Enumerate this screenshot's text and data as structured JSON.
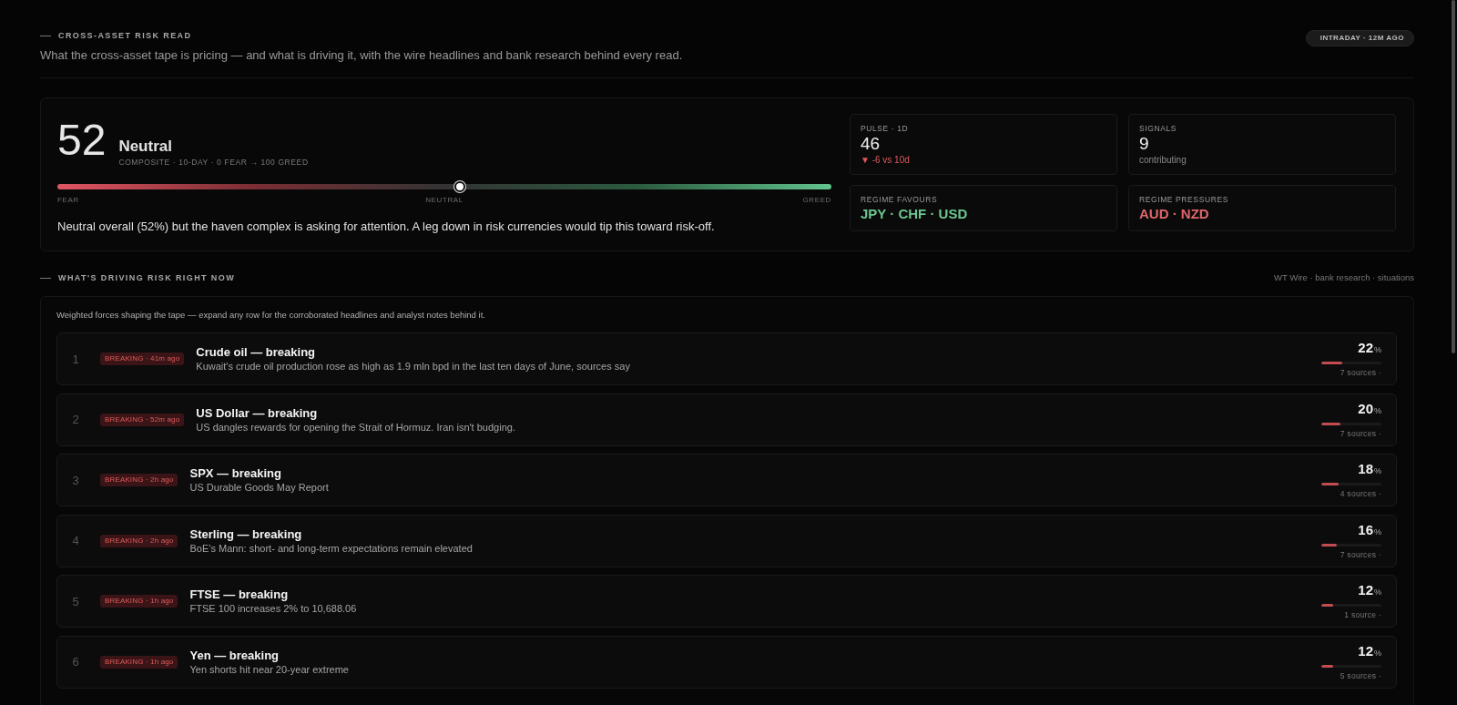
{
  "header": {
    "title": "CROSS-ASSET RISK READ",
    "subtitle": "What the cross-asset tape is pricing — and what is driving it, with the wire headlines and bank research behind every read.",
    "badge": "INTRADAY · 12M AGO"
  },
  "score": {
    "value": "52",
    "label": "Neutral",
    "caption": "COMPOSITE · 10-DAY · 0 FEAR → 100 GREED",
    "gauge": {
      "level": 0.52,
      "labels": [
        "FEAR",
        "NEUTRAL",
        "GREED"
      ]
    },
    "summary": "Neutral overall (52%) but the haven complex is asking for attention. A leg down in risk currencies would tip this toward risk-off."
  },
  "stats": [
    {
      "kind": "metric",
      "label": "PULSE · 1D",
      "value": "46",
      "note": "▼ -6 vs 10d",
      "color": "#de5a5e"
    },
    {
      "kind": "metric",
      "label": "SIGNALS",
      "value": "9",
      "note": "contributing"
    },
    {
      "kind": "currencies",
      "label": "REGIME FAVOURS",
      "value": "JPY · CHF · USD",
      "color": "#6cc690"
    },
    {
      "kind": "currencies",
      "label": "REGIME PRESSURES",
      "value": "AUD · NZD",
      "color": "#e0666c"
    }
  ],
  "drivers": {
    "title": "WHAT'S DRIVING RISK RIGHT NOW",
    "sources": "WT Wire · bank research · situations",
    "intro": "Weighted forces shaping the tape — expand any row for the corroborated headlines and analyst notes behind it.",
    "rows": [
      {
        "rank": "1",
        "badge": "BREAKING · 41m ago",
        "title": "Crude oil — breaking",
        "headline": "Kuwait's crude oil production rose as high as 1.9 mln bpd in the last ten days of June, sources say",
        "weight": "22",
        "unit": "%",
        "level": 0.35,
        "sources": "7 sources ·"
      },
      {
        "rank": "2",
        "badge": "BREAKING · 52m ago",
        "title": "US Dollar — breaking",
        "headline": "US dangles rewards for opening the Strait of Hormuz. Iran isn't budging.",
        "weight": "20",
        "unit": "%",
        "level": 0.32,
        "sources": "7 sources ·"
      },
      {
        "rank": "3",
        "badge": "BREAKING · 2h ago",
        "title": "SPX — breaking",
        "headline": "US Durable Goods May Report",
        "weight": "18",
        "unit": "%",
        "level": 0.29,
        "sources": "4 sources ·"
      },
      {
        "rank": "4",
        "badge": "BREAKING · 2h ago",
        "title": "Sterling — breaking",
        "headline": "BoE’s Mann: short- and long-term expectations remain elevated",
        "weight": "16",
        "unit": "%",
        "level": 0.26,
        "sources": "7 sources ·"
      },
      {
        "rank": "5",
        "badge": "BREAKING · 1h ago",
        "title": "FTSE — breaking",
        "headline": "FTSE 100 increases 2% to 10,688.06",
        "weight": "12",
        "unit": "%",
        "level": 0.2,
        "sources": "1 source ·"
      },
      {
        "rank": "6",
        "badge": "BREAKING · 1h ago",
        "title": "Yen — breaking",
        "headline": "Yen shorts hit near 20-year extreme",
        "weight": "12",
        "unit": "%",
        "level": 0.2,
        "sources": "5 sources ·"
      }
    ]
  }
}
